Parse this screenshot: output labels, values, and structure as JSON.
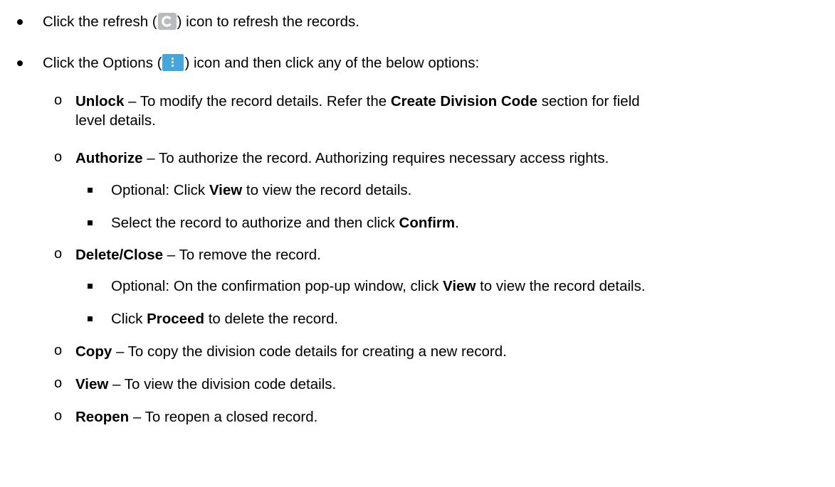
{
  "items": [
    {
      "pre": "Click the refresh (",
      "icon": "refresh-icon",
      "post": ") icon to refresh the records."
    },
    {
      "pre": "Click the Options (",
      "icon": "options-kebab-icon",
      "post": ") icon and then click any of the below options:"
    }
  ],
  "options": {
    "unlock": {
      "label": "Unlock",
      "text1": " – To modify the record details. Refer the ",
      "ref": "Create Division Code",
      "text2": " section for field",
      "text3": "level details."
    },
    "authorize": {
      "label": "Authorize",
      "text": " – To authorize the record. Authorizing requires necessary access rights.",
      "sub1_pre": "Optional: Click ",
      "sub1_bold": "View",
      "sub1_post": " to view the record details.",
      "sub2_pre": "Select the record to authorize and then click ",
      "sub2_bold": "Confirm",
      "sub2_post": "."
    },
    "delete": {
      "label": "Delete/Close",
      "text": " – To remove the record.",
      "sub1_pre": "Optional: On the confirmation pop-up window, click ",
      "sub1_bold": "View",
      "sub1_post": " to view the record details.",
      "sub2_pre": "Click ",
      "sub2_bold": "Proceed",
      "sub2_post": " to delete the record."
    },
    "copy": {
      "label": "Copy",
      "text": " – To copy the division code details for creating a new record."
    },
    "view": {
      "label": "View",
      "text": " – To view the division code details."
    },
    "reopen": {
      "label": "Reopen",
      "text": " – To reopen a closed record."
    }
  },
  "colors": {
    "refresh_icon_bg": "#b9bcbf",
    "options_icon_bg": "#45a6dd"
  }
}
